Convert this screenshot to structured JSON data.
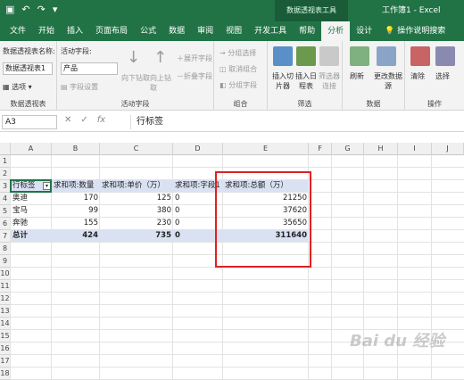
{
  "titlebar": {
    "context_tools": "数据透视表工具",
    "title": "工作簿1 - Excel"
  },
  "tabs": [
    "文件",
    "开始",
    "插入",
    "页面布局",
    "公式",
    "数据",
    "审阅",
    "视图",
    "开发工具",
    "帮助",
    "分析",
    "设计"
  ],
  "active_tab": "分析",
  "tell_me": "操作说明搜索",
  "ribbon": {
    "pt_name_label": "数据透视表名称:",
    "pt_name_value": "数据透视表1",
    "options_label": "选项",
    "pt_group": "数据透视表",
    "active_field_label": "活动字段:",
    "active_field_value": "产品",
    "field_settings": "字段设置",
    "drill_down": "向下钻取",
    "drill_up": "向上钻取",
    "expand_field": "展开字段",
    "collapse_field": "折叠字段",
    "active_field_group": "活动字段",
    "group_selection": "分组选择",
    "ungroup": "取消组合",
    "group_field": "分组字段",
    "group_group": "组合",
    "insert_slicer": "插入切片器",
    "insert_timeline": "插入日程表",
    "filter_connections": "筛选器连接",
    "filter_group": "筛选",
    "refresh": "刷新",
    "change_source": "更改数据源",
    "data_group": "数据",
    "clear": "清除",
    "select": "选择",
    "actions_group": "操作"
  },
  "formula_bar": {
    "name_box": "A3",
    "fx": "fx",
    "formula": "行标签"
  },
  "columns": [
    "A",
    "B",
    "C",
    "D",
    "E",
    "F",
    "G",
    "H",
    "I",
    "J"
  ],
  "rows": [
    "1",
    "2",
    "3",
    "4",
    "5",
    "6",
    "7",
    "8",
    "9",
    "10",
    "11",
    "12",
    "13",
    "14",
    "15",
    "16",
    "17",
    "18"
  ],
  "table": {
    "headers": [
      "行标签",
      "求和项:数量",
      "求和项:单价（万）",
      "求和项:字段1",
      "求和项:总额（万）"
    ],
    "rows": [
      [
        "奥迪",
        "170",
        "125",
        "0",
        "21250"
      ],
      [
        "宝马",
        "99",
        "380",
        "0",
        "37620"
      ],
      [
        "奔驰",
        "155",
        "230",
        "0",
        "35650"
      ]
    ],
    "total": [
      "总计",
      "424",
      "735",
      "0",
      "311640"
    ]
  },
  "watermark": "Bai du 经验"
}
